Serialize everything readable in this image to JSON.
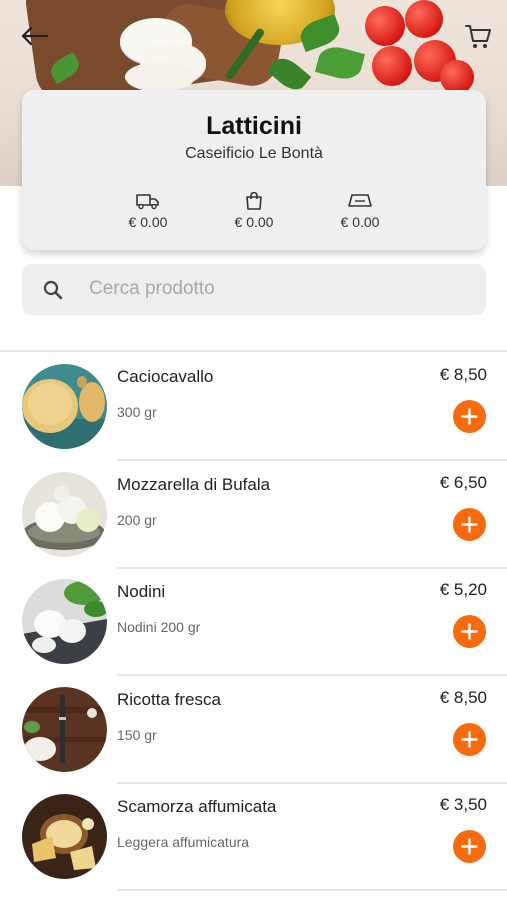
{
  "header": {
    "back_icon": "arrow-left-icon",
    "cart_icon": "cart-icon"
  },
  "store": {
    "title": "Latticini",
    "subtitle": "Caseificio Le Bontà",
    "fees": [
      {
        "icon": "delivery-truck-icon",
        "value": "€ 0.00"
      },
      {
        "icon": "shopping-bag-icon",
        "value": "€ 0.00"
      },
      {
        "icon": "ticket-icon",
        "value": "€ 0.00"
      }
    ]
  },
  "search": {
    "icon": "search-icon",
    "placeholder": "Cerca prodotto"
  },
  "products": [
    {
      "name": "Caciocavallo",
      "description": "300 gr",
      "price": "€ 8,50"
    },
    {
      "name": "Mozzarella di Bufala",
      "description": "200 gr",
      "price": "€ 6,50"
    },
    {
      "name": "Nodini",
      "description": "Nodini 200 gr",
      "price": "€ 5,20"
    },
    {
      "name": "Ricotta fresca",
      "description": "150 gr",
      "price": "€ 8,50"
    },
    {
      "name": "Scamorza affumicata",
      "description": "Leggera affumicatura",
      "price": "€ 3,50"
    }
  ],
  "colors": {
    "accent": "#f76b0e",
    "card_bg": "#efefef",
    "search_bg": "#eeeeee"
  }
}
